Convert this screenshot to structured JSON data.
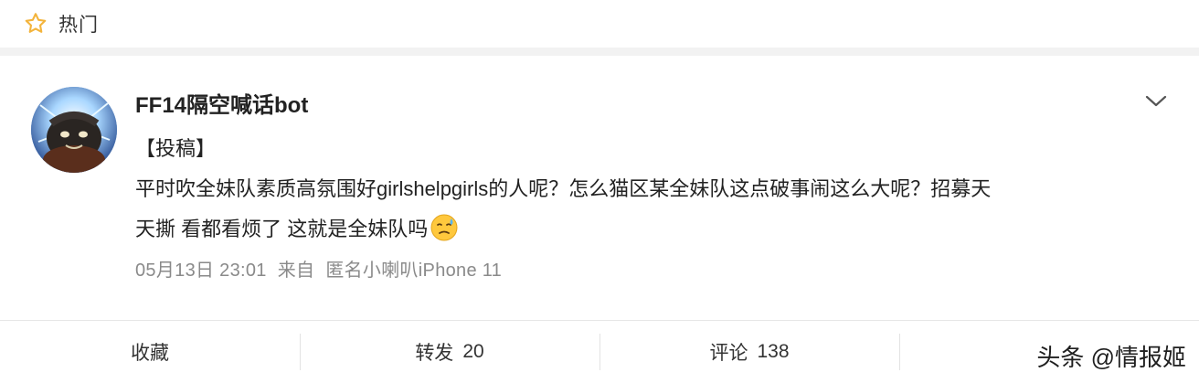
{
  "topbar": {
    "label": "热门",
    "icon": "star-outline-icon",
    "accent": "#f3b43c"
  },
  "post": {
    "username": "FF14隔空喊话bot",
    "tag": "【投稿】",
    "line1": "平时吹全妹队素质高氛围好girlshelpgirls的人呢？怎么猫区某全妹队这点破事闹这么大呢？招募天",
    "line2": "天撕 看都看烦了 这就是全妹队吗",
    "emoji": "sweat-face-emoji",
    "time": "05月13日 23:01",
    "source_prefix": "来自",
    "source": "匿名小喇叭iPhone 11"
  },
  "actions": {
    "favorite": "收藏",
    "repost_label": "转发",
    "repost_count": "20",
    "comment_label": "评论",
    "comment_count": "138"
  },
  "watermark": "头条 @情报姬"
}
